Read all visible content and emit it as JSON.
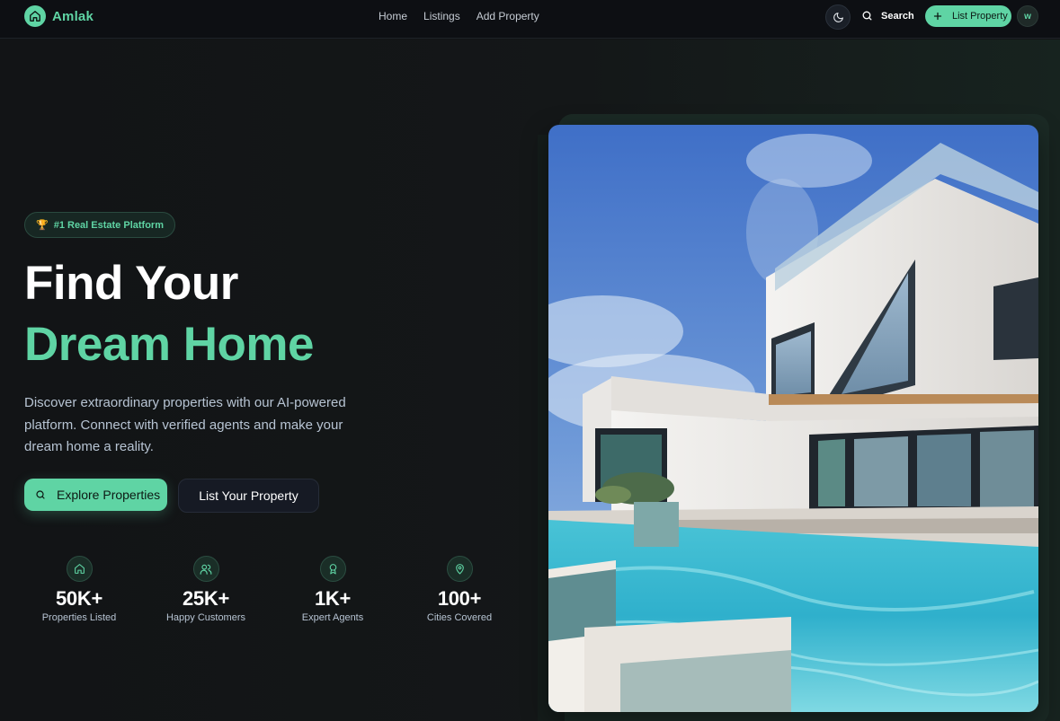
{
  "brand": {
    "name": "Amlak"
  },
  "nav": {
    "links": [
      "Home",
      "Listings",
      "Add Property"
    ],
    "search_label": "Search",
    "list_property_label": "List Property",
    "avatar_initial": "w"
  },
  "hero": {
    "badge_icon": "trophy-icon",
    "badge": "#1 Real Estate Platform",
    "title_line1": "Find Your",
    "title_line2": "Dream Home",
    "description": "Discover extraordinary properties with our AI-powered platform. Connect with verified agents and make your dream home a reality.",
    "explore_label": "Explore Properties",
    "list_label": "List Your Property"
  },
  "stats": [
    {
      "icon": "home-icon",
      "value": "50K+",
      "label": "Properties Listed"
    },
    {
      "icon": "users-icon",
      "value": "25K+",
      "label": "Happy Customers"
    },
    {
      "icon": "award-icon",
      "value": "1K+",
      "label": "Expert Agents"
    },
    {
      "icon": "map-pin-icon",
      "value": "100+",
      "label": "Cities Covered"
    }
  ],
  "colors": {
    "accent": "#5fd4a4",
    "background": "#121416",
    "nav_background": "#0d0f13",
    "muted_text": "#b7c4d3"
  }
}
